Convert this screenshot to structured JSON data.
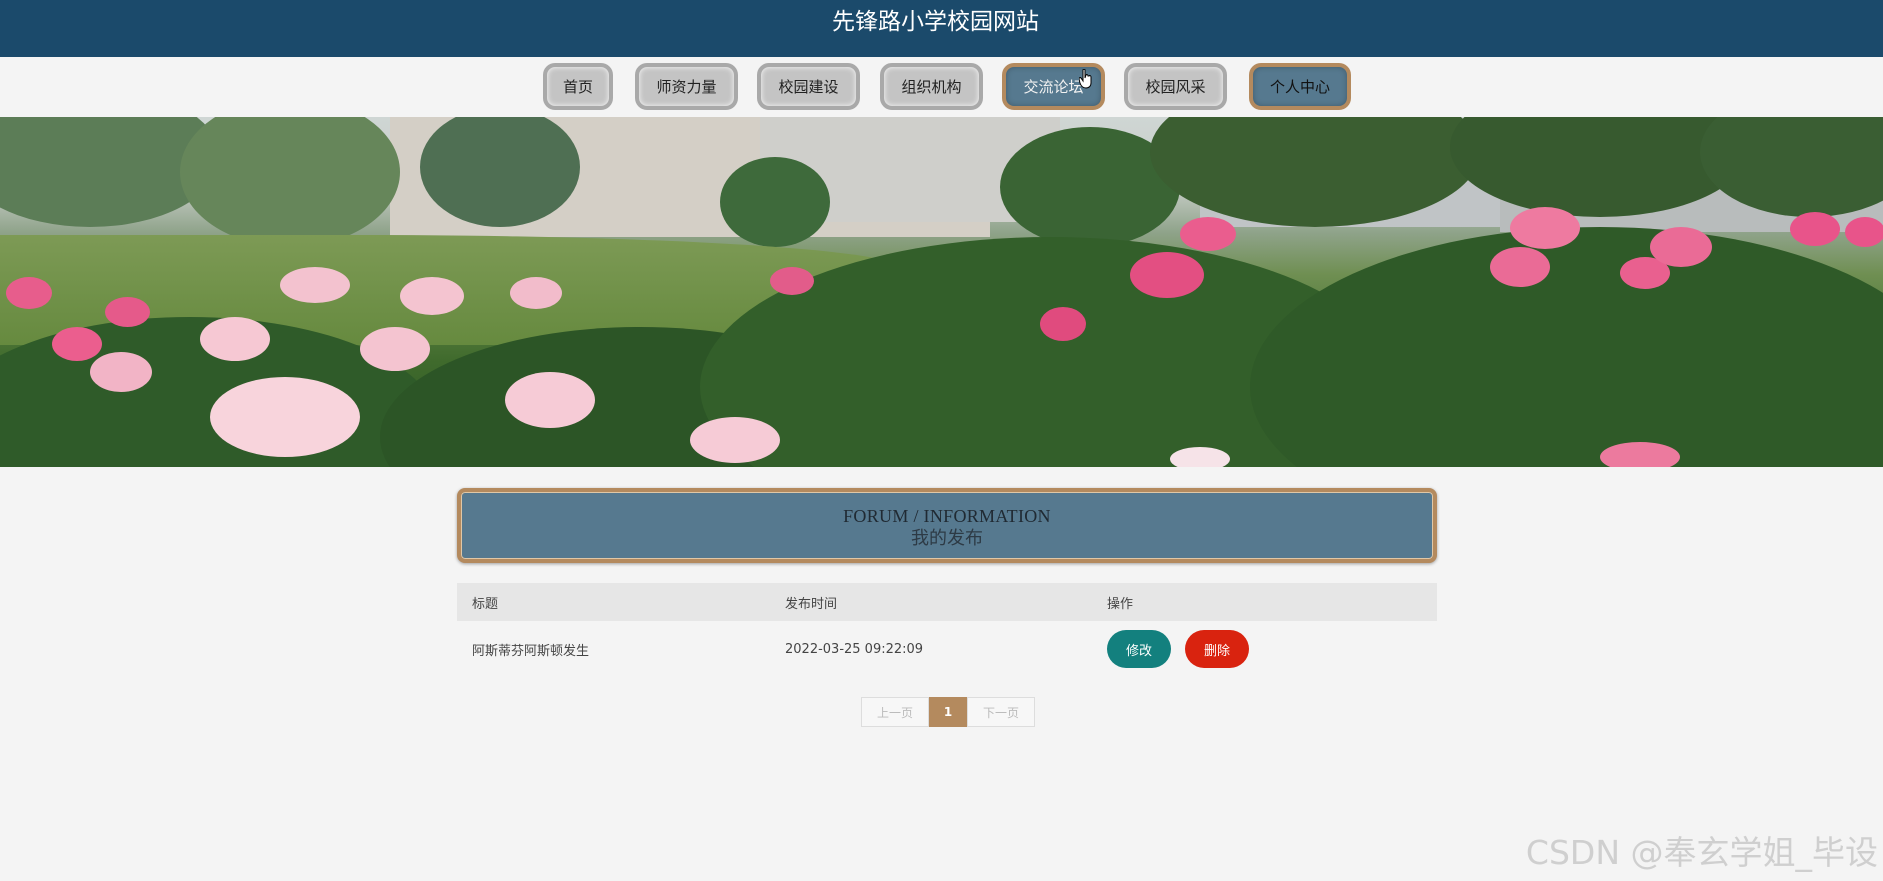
{
  "header": {
    "title": "先锋路小学校园网站"
  },
  "nav": {
    "items": [
      {
        "label": "首页"
      },
      {
        "label": "师资力量"
      },
      {
        "label": "校园建设"
      },
      {
        "label": "组织机构"
      },
      {
        "label": "交流论坛"
      },
      {
        "label": "校园风采"
      },
      {
        "label": "个人中心"
      }
    ],
    "active_items": [
      "交流论坛",
      "个人中心"
    ]
  },
  "forum": {
    "title_en": "FORUM / INFORMATION",
    "title_cn": "我的发布"
  },
  "table": {
    "columns": [
      "标题",
      "发布时间",
      "操作"
    ],
    "rows": [
      {
        "title": "阿斯蒂芬阿斯顿发生",
        "time": "2022-03-25 09:22:09",
        "edit_label": "修改",
        "delete_label": "删除"
      }
    ]
  },
  "pagination": {
    "prev_label": "上一页",
    "current": "1",
    "next_label": "下一页"
  },
  "watermark": "CSDN @奉玄学姐_毕设",
  "colors": {
    "header_bg": "#1b4a6b",
    "accent_blue": "#56798f",
    "accent_gold": "#b48a5e",
    "edit_button": "#13807e",
    "delete_button": "#d9230f"
  }
}
